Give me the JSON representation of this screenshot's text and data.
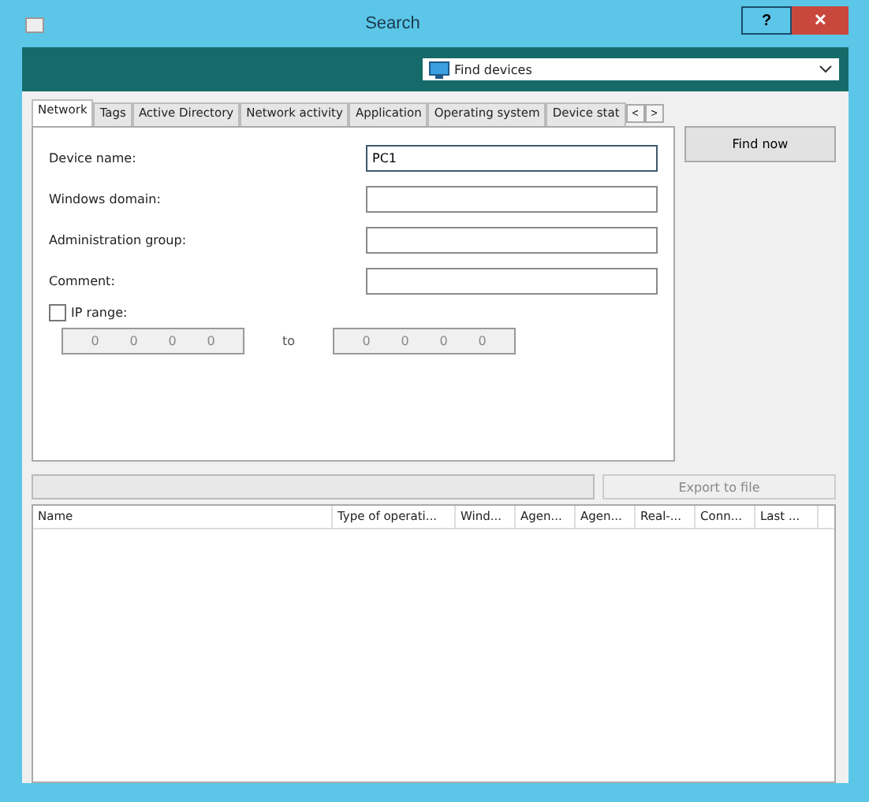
{
  "window": {
    "title": "Search",
    "help": "?",
    "close": "✕"
  },
  "mode_dropdown": {
    "value": "Find devices"
  },
  "tabs": [
    {
      "label": "Network",
      "selected": true
    },
    {
      "label": "Tags",
      "selected": false
    },
    {
      "label": "Active Directory",
      "selected": false
    },
    {
      "label": "Network activity",
      "selected": false
    },
    {
      "label": "Application",
      "selected": false
    },
    {
      "label": "Operating system",
      "selected": false
    },
    {
      "label": "Device stat",
      "selected": false
    }
  ],
  "tab_scroll": [
    "<",
    ">"
  ],
  "fields": [
    {
      "label": "Device name:",
      "value": "PC1",
      "focused": true
    },
    {
      "label": "Windows domain:",
      "focused": false
    },
    {
      "label": "Administration group:",
      "focused": false
    },
    {
      "label": "Comment:",
      "focused": false
    }
  ],
  "ip_range": {
    "label": "IP range:",
    "checked": false,
    "from": [
      "0",
      "0",
      "0",
      "0"
    ],
    "separator": "to",
    "to": [
      "0",
      "0",
      "0",
      "0"
    ]
  },
  "find_button": "Find now",
  "progress": {
    "level": 0
  },
  "export_button": "Export to file",
  "table": {
    "columns": [
      "Name",
      "Type of operati...",
      "Wind...",
      "Agen...",
      "Agen...",
      "Real-...",
      "Conn...",
      "Last ..."
    ]
  }
}
